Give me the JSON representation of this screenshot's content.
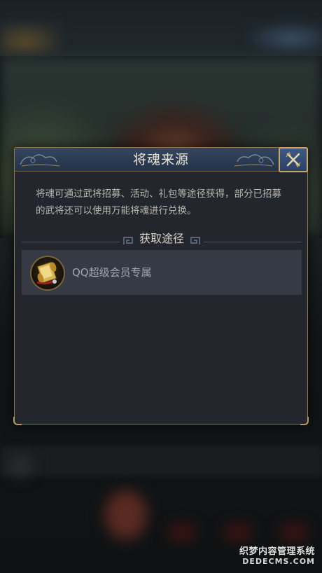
{
  "dialog": {
    "title": "将魂来源",
    "description": "将魂可通过武将招募、活动、礼包等途径获得，部分已招募的武将还可以使用万能将魂进行兑换。",
    "section_title": "获取途径",
    "sources": [
      {
        "label": "QQ超级会员专属",
        "icon": "scroll-icon"
      }
    ],
    "close_icon": "close-icon"
  },
  "watermark": {
    "line1": "织梦内容管理系统",
    "line2": "DEDECMS.COM"
  },
  "colors": {
    "panel": "#23262d",
    "title_bar": "#2e3f56",
    "gold_border": "#8e7a4d",
    "row_bg": "#353a45"
  }
}
